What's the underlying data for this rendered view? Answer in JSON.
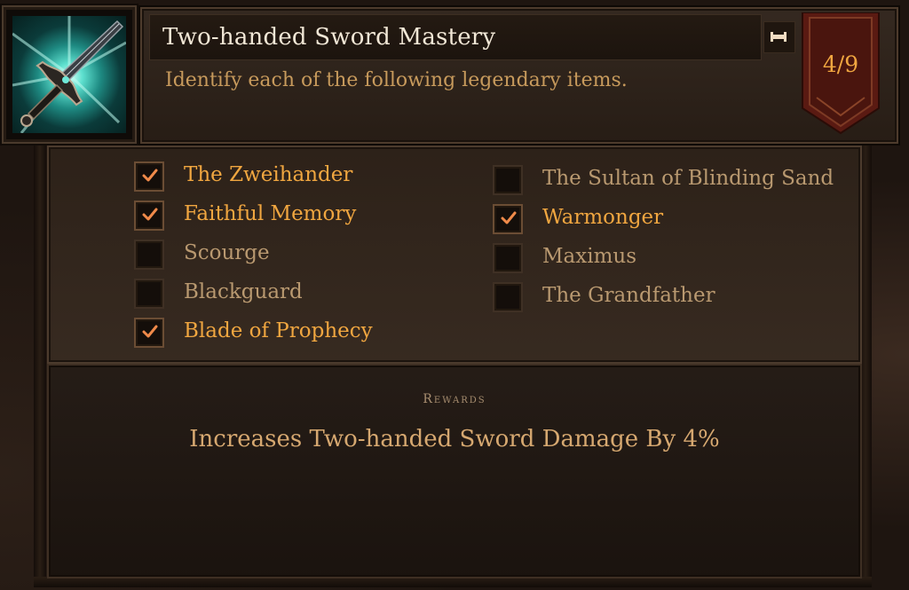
{
  "achievement": {
    "icon": "two-handed-sword-icon",
    "title": "Two-handed Sword Mastery",
    "description": "Identify each of the following legendary items.",
    "progress_text": "4/9",
    "pin_icon": "pin-icon"
  },
  "checklist": {
    "left": [
      {
        "label": "The Zweihander",
        "checked": true
      },
      {
        "label": "Faithful Memory",
        "checked": true
      },
      {
        "label": "Scourge",
        "checked": false
      },
      {
        "label": "Blackguard",
        "checked": false
      },
      {
        "label": "Blade of Prophecy",
        "checked": true
      }
    ],
    "right": [
      {
        "label": "The Sultan of Blinding Sand",
        "checked": false
      },
      {
        "label": "Warmonger",
        "checked": true
      },
      {
        "label": "Maximus",
        "checked": false
      },
      {
        "label": "The Grandfather",
        "checked": false
      }
    ]
  },
  "rewards": {
    "heading": "Rewards",
    "text": "Increases Two-handed Sword Damage By 4%"
  },
  "colors": {
    "completed_text": "#f0a640",
    "incomplete_text": "#b99970",
    "title_text": "#f1e7d6",
    "banner_red": "#5a1a12"
  }
}
